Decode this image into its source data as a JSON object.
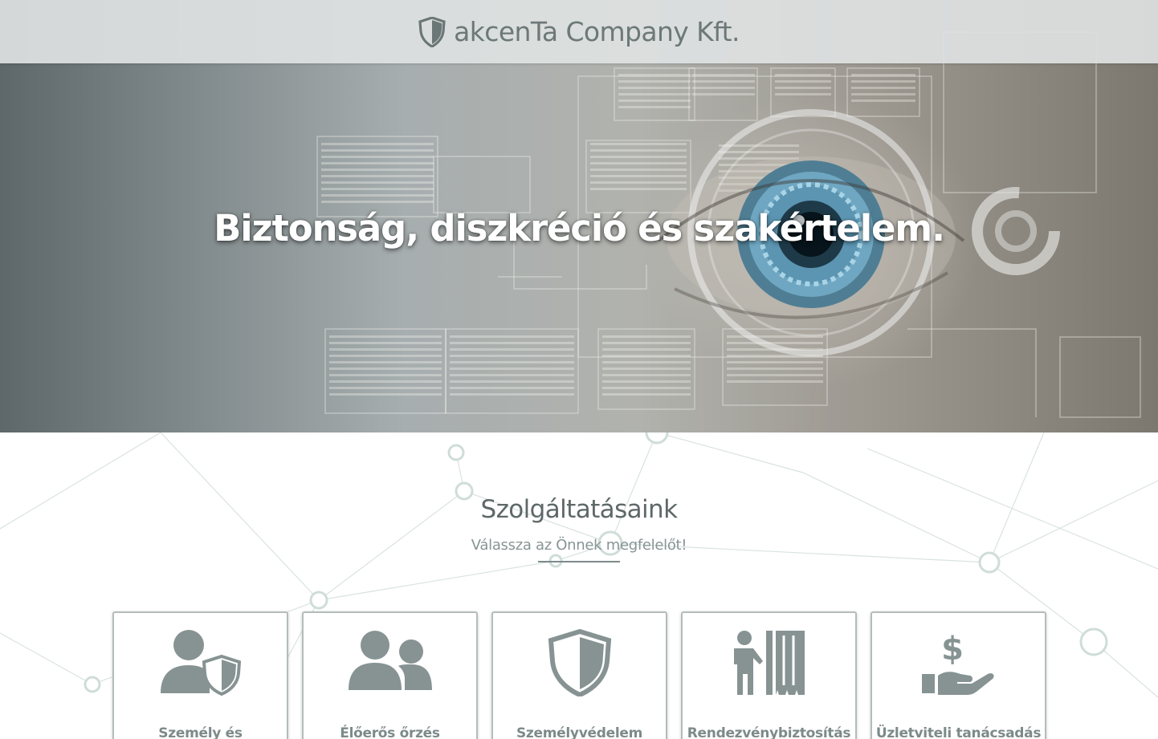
{
  "header": {
    "brand_name": "akcenTa Company Kft.",
    "brand_icon": "shield-icon"
  },
  "hero": {
    "headline": "Biztonság, diszkréció és szakértelem."
  },
  "services": {
    "title": "Szolgáltatásaink",
    "subtitle": "Válassza az Önnek megfelelőt!",
    "cards": [
      {
        "label": "Személy és",
        "icon": "person-shield-icon"
      },
      {
        "label": "Élőerős őrzés",
        "icon": "guards-icon"
      },
      {
        "label": "Személyvédelem",
        "icon": "shield-icon"
      },
      {
        "label": "Rendezvénybiztosítás",
        "icon": "event-curtain-icon"
      },
      {
        "label": "Üzletviteli tanácsadás",
        "icon": "hand-dollar-icon"
      }
    ]
  },
  "colors": {
    "accent": "#7e8a8a",
    "icon": "#879393",
    "text_dark": "#5f6868",
    "text_light": "#889494",
    "card_border": "#b4bcbc"
  }
}
